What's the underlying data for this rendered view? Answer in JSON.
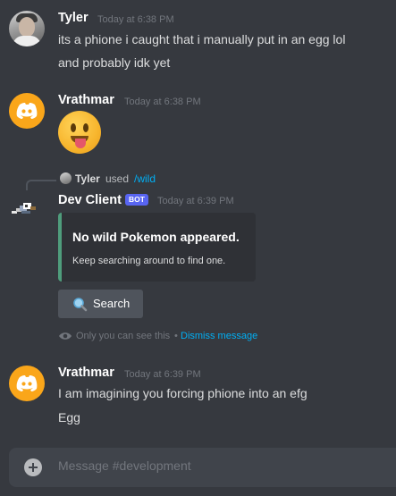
{
  "messages": [
    {
      "author": "Tyler",
      "timestamp": "Today at 6:38 PM",
      "lines": [
        "its a phione i caught that i manually put in an egg lol",
        "and probably idk yet"
      ]
    },
    {
      "author": "Vrathmar",
      "timestamp": "Today at 6:38 PM",
      "emoji": "tongue-out-face"
    },
    {
      "reply": {
        "user": "Tyler",
        "used": "used",
        "command": "/wild"
      },
      "author": "Dev Client",
      "badge": "BOT",
      "timestamp": "Today at 6:39 PM",
      "embed": {
        "title": "No wild Pokemon appeared.",
        "description": "Keep searching around to find one.",
        "accent_color": "#4f9d7c"
      },
      "button": {
        "label": "Search",
        "icon": "magnifier-icon"
      },
      "ephemeral": {
        "text": "Only you can see this",
        "separator": "•",
        "dismiss": "Dismiss message"
      }
    },
    {
      "author": "Vrathmar",
      "timestamp": "Today at 6:39 PM",
      "lines": [
        "I am imagining you forcing phione into an efg",
        "Egg"
      ]
    }
  ],
  "composer": {
    "placeholder": "Message #development"
  },
  "colors": {
    "background": "#36393f",
    "link": "#00aff4",
    "bot_badge": "#5865f2",
    "discord_avatar": "#faa61a"
  }
}
